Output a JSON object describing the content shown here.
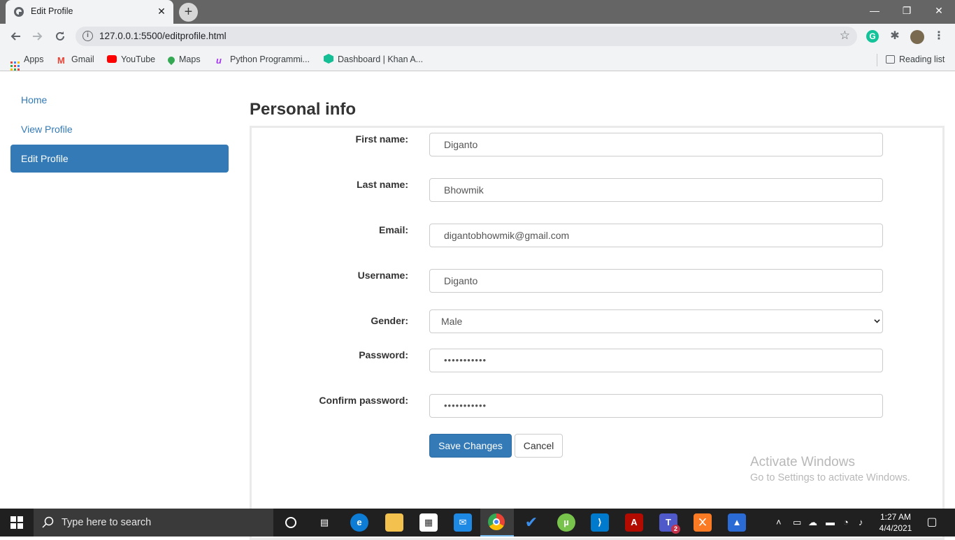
{
  "browser": {
    "tab_title": "Edit Profile",
    "tab_close": "✕",
    "new_tab": "+",
    "url": "127.0.0.1:5500/editprofile.html",
    "window_controls": {
      "minimize": "—",
      "restore": "❐",
      "close": "✕"
    },
    "bookmarks": [
      {
        "label": "Apps",
        "icon": "apps-grid-icon"
      },
      {
        "label": "Gmail",
        "icon": "gmail-icon"
      },
      {
        "label": "YouTube",
        "icon": "youtube-icon"
      },
      {
        "label": "Maps",
        "icon": "maps-icon"
      },
      {
        "label": "Python Programmi...",
        "icon": "udemy-icon"
      },
      {
        "label": "Dashboard | Khan A...",
        "icon": "khan-academy-icon"
      }
    ],
    "reading_list": "Reading list"
  },
  "sidebar": {
    "items": [
      {
        "label": "Home",
        "active": false
      },
      {
        "label": "View Profile",
        "active": false
      },
      {
        "label": "Edit Profile",
        "active": true
      }
    ]
  },
  "form": {
    "heading": "Personal info",
    "first_name": {
      "label": "First name:",
      "value": "Diganto"
    },
    "last_name": {
      "label": "Last name:",
      "value": "Bhowmik"
    },
    "email": {
      "label": "Email:",
      "value": "digantobhowmik@gmail.com"
    },
    "username": {
      "label": "Username:",
      "value": "Diganto"
    },
    "gender": {
      "label": "Gender:",
      "value": "Male"
    },
    "password": {
      "label": "Password:",
      "value": "•••••••••••"
    },
    "confirm_password": {
      "label": "Confirm password:",
      "value": "•••••••••••"
    },
    "save_label": "Save Changes",
    "cancel_label": "Cancel"
  },
  "watermark": {
    "title": "Activate Windows",
    "subtitle": "Go to Settings to activate Windows."
  },
  "taskbar": {
    "search_placeholder": "Type here to search",
    "time": "1:27 AM",
    "date": "4/4/2021",
    "teams_badge": "2"
  },
  "colors": {
    "accent": "#337ab7",
    "tabstrip": "#656565",
    "taskbar": "#202020"
  }
}
